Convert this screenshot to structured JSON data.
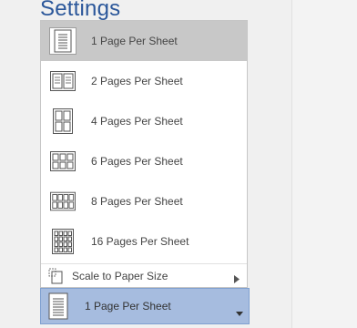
{
  "section_title": "Settings",
  "menu": {
    "items": [
      {
        "label": "1 Page Per Sheet",
        "icon": "one-page-per-sheet-icon",
        "selected": true
      },
      {
        "label": "2 Pages Per Sheet",
        "icon": "two-pages-per-sheet-icon"
      },
      {
        "label": "4 Pages Per Sheet",
        "icon": "four-pages-per-sheet-icon"
      },
      {
        "label": "6 Pages Per Sheet",
        "icon": "six-pages-per-sheet-icon"
      },
      {
        "label": "8 Pages Per Sheet",
        "icon": "eight-pages-per-sheet-icon"
      },
      {
        "label": "16 Pages Per Sheet",
        "icon": "sixteen-pages-per-sheet-icon"
      }
    ],
    "scale_label": "Scale to Paper Size"
  },
  "dropdown": {
    "selected_label": "1 Page Per Sheet"
  },
  "colors": {
    "title": "#2b579a",
    "selected_item_bg": "#c8c8c8",
    "dropdown_bg": "#a6bcdf"
  }
}
